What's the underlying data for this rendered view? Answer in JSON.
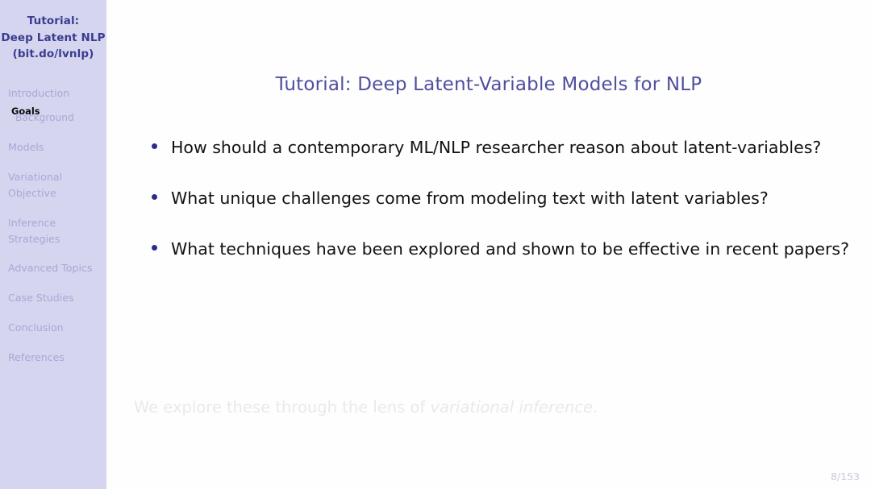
{
  "sidebar": {
    "title_lines": [
      "Tutorial:",
      "Deep Latent NLP",
      "(bit.do/lvnlp)"
    ],
    "nav": [
      {
        "label": "Introduction",
        "lines": [
          "Introduction"
        ],
        "active": false,
        "sub": false
      },
      {
        "label": "Goals",
        "lines": [
          "Goals"
        ],
        "active": true,
        "sub": true
      },
      {
        "label": "Background",
        "lines": [
          "Background"
        ],
        "active": false,
        "sub": true
      },
      {
        "label": "Models",
        "lines": [
          "Models"
        ],
        "active": false,
        "sub": false
      },
      {
        "label": "Variational Objective",
        "lines": [
          "Variational",
          "Objective"
        ],
        "active": false,
        "sub": false
      },
      {
        "label": "Inference Strategies",
        "lines": [
          "Inference",
          "Strategies"
        ],
        "active": false,
        "sub": false
      },
      {
        "label": "Advanced Topics",
        "lines": [
          "Advanced Topics"
        ],
        "active": false,
        "sub": false
      },
      {
        "label": "Case Studies",
        "lines": [
          "Case Studies"
        ],
        "active": false,
        "sub": false
      },
      {
        "label": "Conclusion",
        "lines": [
          "Conclusion"
        ],
        "active": false,
        "sub": false
      },
      {
        "label": "References",
        "lines": [
          "References"
        ],
        "active": false,
        "sub": false
      }
    ]
  },
  "main": {
    "title": "Tutorial: Deep Latent-Variable Models for NLP",
    "bullets": [
      "How should a contemporary ML/NLP researcher reason about latent-variables?",
      "What unique challenges come from modeling text with latent variables?",
      "What techniques have been explored and shown to be effective in recent papers?"
    ],
    "closing": {
      "prefix": "We explore these through the lens of ",
      "emphasis": "variational inference",
      "suffix": "."
    },
    "page_number": "8/153"
  },
  "colors": {
    "sidebar_bg": "#d5d5f0",
    "sidebar_title": "#3b3b8f",
    "nav_inactive": "#a8a8d4",
    "nav_active": "#0a0a0a",
    "slide_title": "#4f4f9e",
    "body_text": "#121212",
    "bullet_marker": "#2b2b8c",
    "faded_text": "#e9e9ed",
    "page_number": "#c9c9e0"
  }
}
